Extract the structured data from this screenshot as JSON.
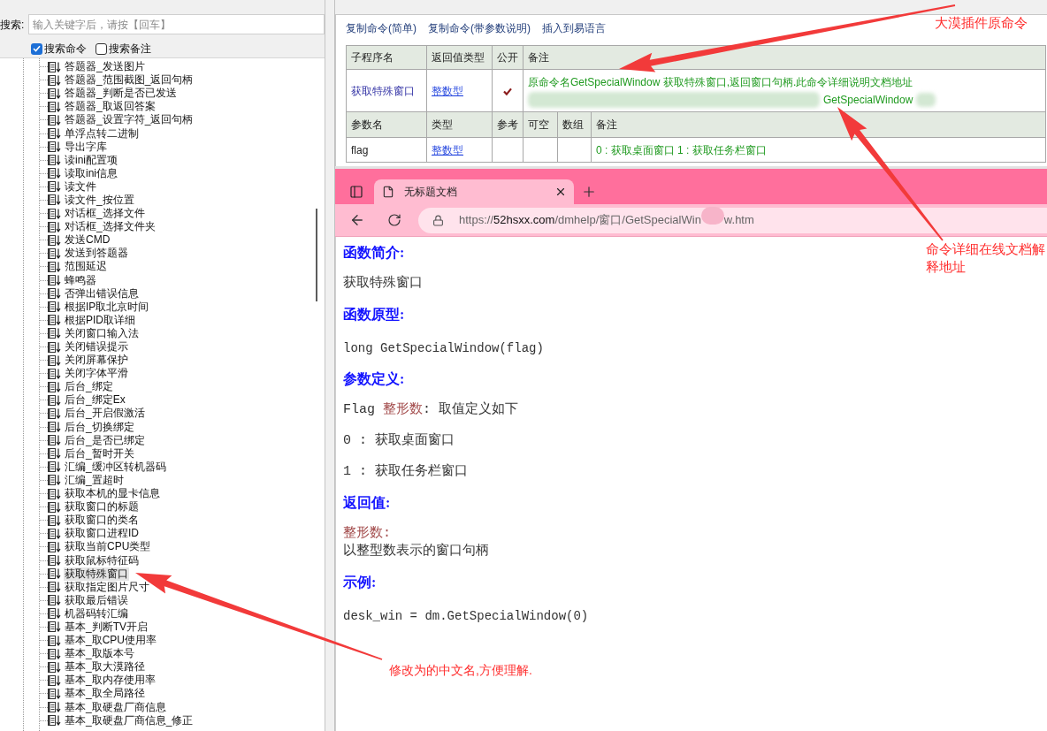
{
  "search": {
    "label": "搜索:",
    "placeholder": "输入关键字后，请按【回车】"
  },
  "search_options": [
    {
      "label": "搜索命令",
      "checked": true
    },
    {
      "label": "搜索备注",
      "checked": false
    }
  ],
  "tree": {
    "items": [
      {
        "label": "答题器_发送图片",
        "selected": false
      },
      {
        "label": "答题器_范围截图_返回句柄",
        "selected": false
      },
      {
        "label": "答题器_判断是否已发送",
        "selected": false
      },
      {
        "label": "答题器_取返回答案",
        "selected": false
      },
      {
        "label": "答题器_设置字符_返回句柄",
        "selected": false
      },
      {
        "label": "单浮点转二进制",
        "selected": false
      },
      {
        "label": "导出字库",
        "selected": false
      },
      {
        "label": "读ini配置项",
        "selected": false
      },
      {
        "label": "读取ini信息",
        "selected": false
      },
      {
        "label": "读文件",
        "selected": false
      },
      {
        "label": "读文件_按位置",
        "selected": false
      },
      {
        "label": "对话框_选择文件",
        "selected": false
      },
      {
        "label": "对话框_选择文件夹",
        "selected": false
      },
      {
        "label": "发送CMD",
        "selected": false
      },
      {
        "label": "发送到答题器",
        "selected": false
      },
      {
        "label": "范围延迟",
        "selected": false
      },
      {
        "label": "蜂鸣器",
        "selected": false
      },
      {
        "label": "否弹出错误信息",
        "selected": false
      },
      {
        "label": "根据IP取北京时间",
        "selected": false
      },
      {
        "label": "根据PID取详细",
        "selected": false
      },
      {
        "label": "关闭窗口输入法",
        "selected": false
      },
      {
        "label": "关闭错误提示",
        "selected": false
      },
      {
        "label": "关闭屏幕保护",
        "selected": false
      },
      {
        "label": "关闭字体平滑",
        "selected": false
      },
      {
        "label": "后台_绑定",
        "selected": false
      },
      {
        "label": "后台_绑定Ex",
        "selected": false
      },
      {
        "label": "后台_开启假激活",
        "selected": false
      },
      {
        "label": "后台_切换绑定",
        "selected": false
      },
      {
        "label": "后台_是否已绑定",
        "selected": false
      },
      {
        "label": "后台_暂时开关",
        "selected": false
      },
      {
        "label": "汇编_缓冲区转机器码",
        "selected": false
      },
      {
        "label": "汇编_置超时",
        "selected": false
      },
      {
        "label": "获取本机的显卡信息",
        "selected": false
      },
      {
        "label": "获取窗口的标题",
        "selected": false
      },
      {
        "label": "获取窗口的类名",
        "selected": false
      },
      {
        "label": "获取窗口进程ID",
        "selected": false
      },
      {
        "label": "获取当前CPU类型",
        "selected": false
      },
      {
        "label": "获取鼠标特征码",
        "selected": false
      },
      {
        "label": "获取特殊窗口",
        "selected": true
      },
      {
        "label": "获取指定图片尺寸",
        "selected": false
      },
      {
        "label": "获取最后错误",
        "selected": false
      },
      {
        "label": "机器码转汇编",
        "selected": false
      },
      {
        "label": "基本_判断TV开启",
        "selected": false
      },
      {
        "label": "基本_取CPU使用率",
        "selected": false
      },
      {
        "label": "基本_取版本号",
        "selected": false
      },
      {
        "label": "基本_取大漠路径",
        "selected": false
      },
      {
        "label": "基本_取内存使用率",
        "selected": false
      },
      {
        "label": "基本_取全局路径",
        "selected": false
      },
      {
        "label": "基本_取硬盘厂商信息",
        "selected": false
      },
      {
        "label": "基本_取硬盘厂商信息_修正",
        "selected": false
      }
    ]
  },
  "command_toolbar": [
    "复制命令(简单)",
    "复制命令(带参数说明)",
    "插入到易语言"
  ],
  "command_table": {
    "columns": [
      "子程序名",
      "返回值类型",
      "公开",
      "备注"
    ],
    "rows": [
      {
        "name": "获取特殊窗口",
        "return_type": "整数型",
        "public": true,
        "remark": "原命令名GetSpecialWindow 获取特殊窗口,返回窗口句柄.此命令详细说明文档地址",
        "remark_line_2": "GetSpecialWindow"
      }
    ]
  },
  "param_table": {
    "columns": [
      "参数名",
      "类型",
      "参考",
      "可空",
      "数组",
      "备注"
    ],
    "rows": [
      {
        "name": "flag",
        "type": "整数型",
        "remark": "0 : 获取桌面窗口 1 : 获取任务栏窗口"
      }
    ]
  },
  "browser": {
    "tab": {
      "title": "无标题文档"
    },
    "url": {
      "scheme": "https://",
      "host": "52hsxx.com",
      "path": "/dmhelp/窗口/GetSpecialWin",
      "after_cover": "w.htm"
    }
  },
  "doc": {
    "sections": [
      {
        "heading": "函数简介:",
        "lines": [
          {
            "kind": "text",
            "text": "获取特殊窗口"
          }
        ]
      },
      {
        "heading": "函数原型:",
        "lines": [
          {
            "kind": "code",
            "text": "long GetSpecialWindow(flag)"
          }
        ]
      },
      {
        "heading": "参数定义:",
        "lines": [
          {
            "kind": "param",
            "name": "Flag",
            "type": "整形数",
            "text": ": 取值定义如下"
          },
          {
            "kind": "text",
            "text": "0 : 获取桌面窗口"
          },
          {
            "kind": "text",
            "text": "1 : 获取任务栏窗口"
          }
        ]
      },
      {
        "heading": "返回值:",
        "lines": [
          {
            "kind": "return",
            "type": "整形数:",
            "text": "以整型数表示的窗口句柄"
          }
        ]
      },
      {
        "heading": "示例:",
        "lines": [
          {
            "kind": "code",
            "text": "desk_win = dm.GetSpecialWindow(0)"
          }
        ]
      }
    ]
  },
  "annotations": [
    {
      "text": "大漠插件原命令"
    },
    {
      "text": "命令详细在线文档解释地址"
    },
    {
      "text": "修改为的中文名,方便理解."
    }
  ]
}
